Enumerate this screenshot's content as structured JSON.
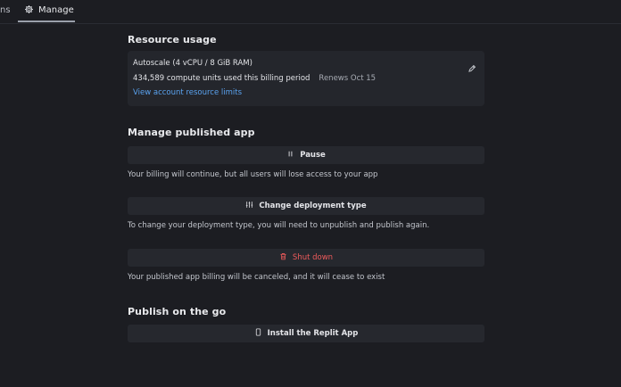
{
  "tabs": {
    "partial_label": "ns",
    "active_label": "Manage"
  },
  "resource_usage": {
    "title": "Resource usage",
    "plan": "Autoscale (4 vCPU / 8 GiB RAM)",
    "compute_units": "434,589 compute units used this billing period",
    "renews": "Renews Oct 15",
    "limits_link": "View account resource limits"
  },
  "manage_app": {
    "title": "Manage published app",
    "pause_label": "Pause",
    "pause_desc": "Your billing will continue, but all users will lose access to your app",
    "change_label": "Change deployment type",
    "change_desc": "To change your deployment type, you will need to unpublish and publish again.",
    "shutdown_label": "Shut down",
    "shutdown_desc": "Your published app billing will be canceled, and it will cease to exist"
  },
  "publish_go": {
    "title": "Publish on the go",
    "install_label": "Install the Replit App"
  },
  "colors": {
    "background": "#1c1d22",
    "card": "#24262c",
    "link": "#5aa3f0",
    "danger": "#ef5b5b"
  },
  "icons": [
    "gear-icon",
    "pencil-icon",
    "pause-icon",
    "sliders-icon",
    "trash-icon",
    "phone-icon"
  ]
}
